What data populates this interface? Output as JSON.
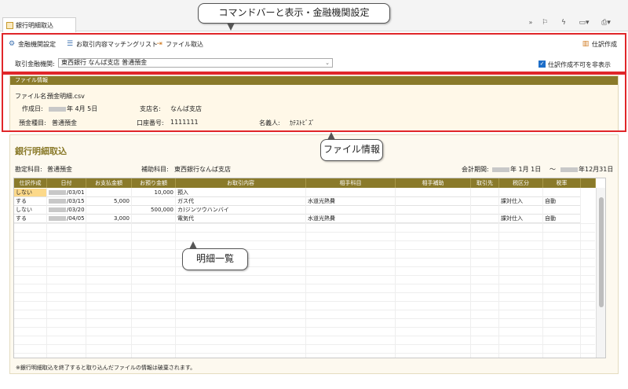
{
  "tab": {
    "title": "銀行明細取込"
  },
  "toolbar": {
    "setting": "金融機関設定",
    "matching": "お取引内容マッチングリスト",
    "import": "ファイル取込",
    "create": "仕訳作成"
  },
  "filter": {
    "bank_label": "取引金融機関:",
    "bank_value": "東西銀行 なんば支店 普通預金",
    "hide_label": "仕訳作成不可を非表示"
  },
  "fileinfo": {
    "header": "ファイル情報",
    "filename_label": "ファイル名:",
    "filename": "預金明細.csv",
    "created_label": "作成日:",
    "created": "年 4月 5日",
    "branch_label": "支店名:",
    "branch": "なんば支店",
    "type_label": "預金種目:",
    "type": "普通預金",
    "account_label": "口座番号:",
    "account": "1111111",
    "holder_label": "名義人:",
    "holder": "ｶﾃｽﾄﾋﾞｽﾞ"
  },
  "main": {
    "title": "銀行明細取込",
    "account_label": "勘定科目:",
    "account": "普通預金",
    "sub_label": "補助科目:",
    "sub": "東西銀行なんば支店",
    "period_label": "会計期間:",
    "period_start": "年 1月 1日",
    "period_sep": "〜",
    "period_end": "年12月31日",
    "footnote": "※銀行明細取込を終了すると取り込んだファイルの情報は破棄されます。"
  },
  "table": {
    "headers": [
      "仕訳作成",
      "日付",
      "お支払金額",
      "お預り金額",
      "お取引内容",
      "相手科目",
      "相手補助",
      "取引先",
      "税区分",
      "税率"
    ],
    "rows": [
      [
        "しない",
        "/03/01",
        "",
        "10,000",
        "預入",
        "",
        "",
        "",
        "",
        ""
      ],
      [
        "する",
        "/03/15",
        "5,000",
        "",
        "ガス代",
        "水道光熱費",
        "",
        "",
        "課対仕入",
        "自動"
      ],
      [
        "しない",
        "/03/20",
        "",
        "500,000",
        "カ)ジンツウハンバイ",
        "",
        "",
        "",
        "",
        ""
      ],
      [
        "する",
        "/04/05",
        "3,000",
        "",
        "電気代",
        "水道光熱費",
        "",
        "",
        "課対仕入",
        "自動"
      ]
    ]
  },
  "callouts": {
    "cmd": "コマンドバーと表示・金融機関設定",
    "file": "ファイル情報",
    "list": "明細一覧"
  },
  "colors": {
    "accent": "#8a7a2a",
    "highlight": "#e0262a"
  }
}
